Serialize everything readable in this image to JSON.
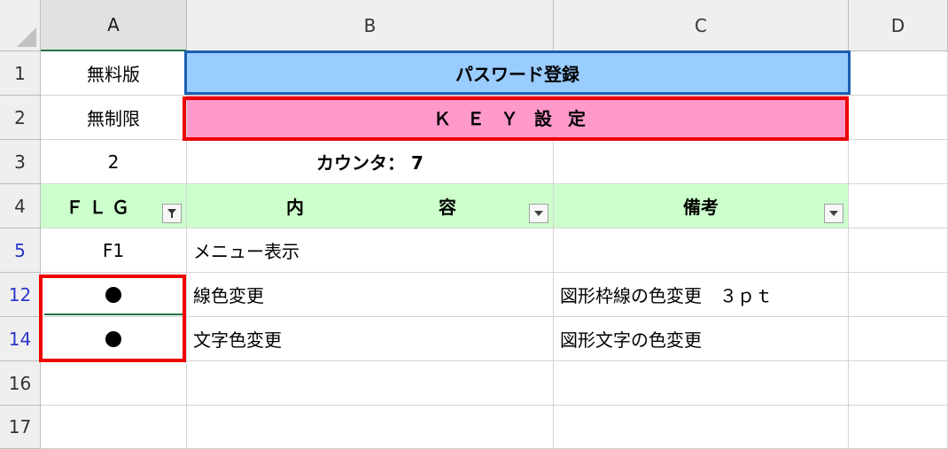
{
  "column_headers": [
    "A",
    "B",
    "C",
    "D"
  ],
  "row_headers": [
    "1",
    "2",
    "3",
    "4",
    "5",
    "12",
    "14",
    "16",
    "17"
  ],
  "cells": {
    "a1": "無料版",
    "b1": "パスワード登録",
    "a2": "無制限",
    "b2": "ＫＥＹ設定",
    "a3": "2",
    "b3": "カウンタ： 7",
    "a4": "ＦＬＧ",
    "b4_left": "内",
    "b4_right": "容",
    "c4": "備考",
    "a5": "F1",
    "b5": "メニュー表示",
    "b12": "線色変更",
    "c12": "図形枠線の色変更　３ｐｔ",
    "b14": "文字色変更",
    "c14": "図形文字の色変更"
  },
  "icons": {
    "flag_dot": "filled-circle",
    "filter_active": "funnel-filter-icon",
    "filter_dropdown": "chevron-down-icon"
  },
  "colors": {
    "header_green": "#ccffcc",
    "title_blue": "#99ccff",
    "key_pink": "#ff99cc",
    "highlight_red": "#ee0000",
    "filtered_row_number": "#2b37c9"
  }
}
